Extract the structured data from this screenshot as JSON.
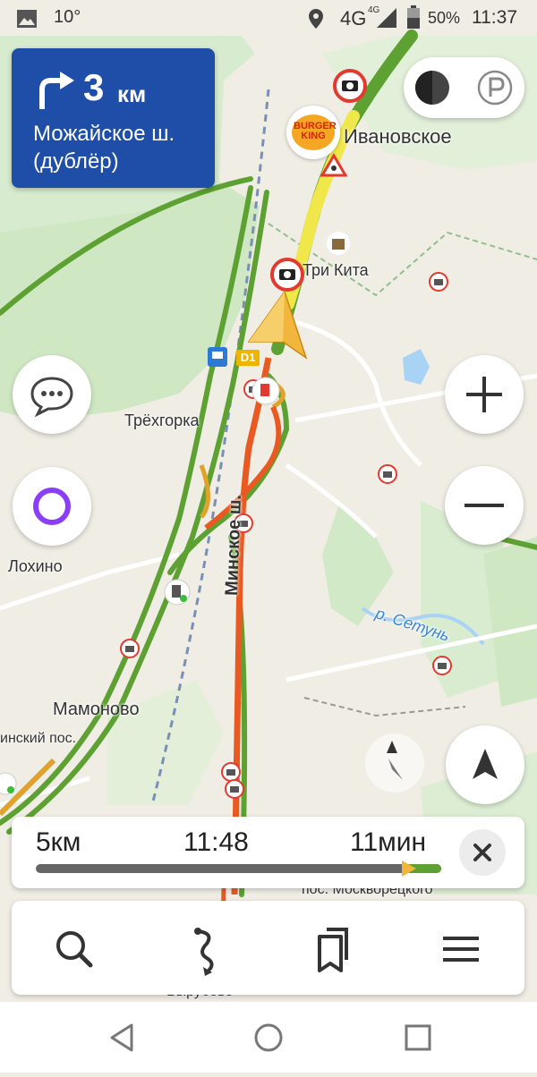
{
  "status_bar": {
    "temperature": "10°",
    "network": "4G",
    "network_small": "4G",
    "battery": "50%",
    "time": "11:37"
  },
  "maneuver": {
    "distance": "3",
    "unit": "км",
    "street": "Можайское ш. (дублёр)"
  },
  "map": {
    "labels": {
      "ivanovskoe": "Ивановское",
      "tri_kita": "Три Кита",
      "trekhgorka": "Трёхгорка",
      "lokhino": "Лохино",
      "mamonovo": "Мамоново",
      "minsky_pos": "инский пос.",
      "minskoe_sh": "Минское ш.",
      "setun": "р. Сетунь",
      "moskvoretsky": "пос. Москворецкого",
      "vyrubovo": "Вырубово",
      "road_shield": "D1",
      "burger_king": "BURGER KING"
    }
  },
  "route_panel": {
    "distance": "5км",
    "arrival": "11:48",
    "duration": "11мин",
    "progress": 0.93
  },
  "toolbar": {
    "items": [
      "search",
      "route",
      "bookmarks",
      "menu"
    ]
  },
  "colors": {
    "maneuver_bg": "#1f4ea8",
    "alice_purple": "#8a3ff6",
    "route_green": "#5da132",
    "route_red": "#e85a22",
    "route_yellow": "#f0e84a",
    "camera_red": "#e23a2f"
  }
}
